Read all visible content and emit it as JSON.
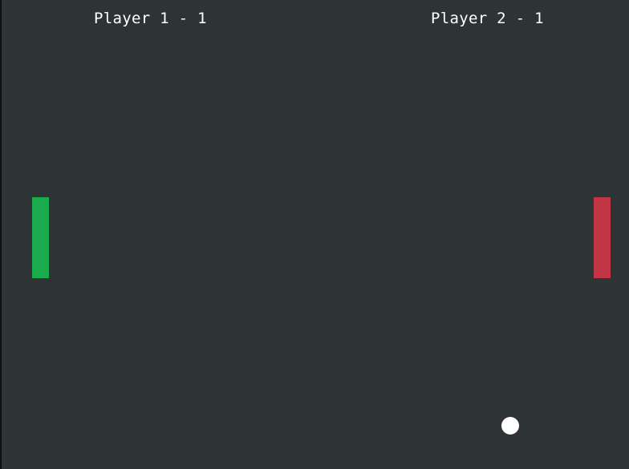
{
  "game": {
    "scores": {
      "player1": {
        "label": "Player 1 - 1"
      },
      "player2": {
        "label": "Player 2 - 1"
      }
    },
    "paddles": {
      "left": {
        "color": "#1aac4c"
      },
      "right": {
        "color": "#c13545"
      }
    },
    "ball": {
      "color": "#ffffff"
    },
    "background": "#2e3436"
  }
}
